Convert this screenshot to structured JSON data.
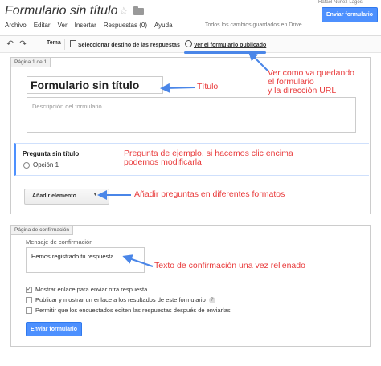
{
  "header": {
    "title": "Formulario sin título",
    "user_name": "Rafael Nuñez-Lagos",
    "send_button": "Enviar formulario",
    "star_icon": "star-icon",
    "folder_icon": "folder-icon"
  },
  "menu": {
    "items": [
      "Archivo",
      "Editar",
      "Ver",
      "Insertar",
      "Respuestas (0)",
      "Ayuda"
    ],
    "saved_status": "Todos los cambios guardados en Drive"
  },
  "toolbar": {
    "theme_label": "Tema",
    "destination_label": "Seleccionar destino de las respuestas",
    "view_published_label": "Ver el formulario publicado"
  },
  "page": {
    "page_tag": "Página 1 de 1",
    "form_title": "Formulario sin título",
    "description_placeholder": "Descripción del formulario"
  },
  "question": {
    "title": "Pregunta sin título",
    "option_1": "Opción 1"
  },
  "add_item": {
    "label": "Añadir elemento"
  },
  "confirmation": {
    "tag": "Página de confirmación",
    "message_label": "Mensaje de confirmación",
    "message_value": "Hemos registrado tu respuesta.",
    "option_1": "Mostrar enlace para enviar otra respuesta",
    "option_1_checked": true,
    "option_2": "Publicar y mostrar un enlace a los resultados de este formulario",
    "option_2_checked": false,
    "option_3": "Permitir que los encuestados editen las respuestas después de enviarlas",
    "option_3_checked": false,
    "send_button": "Enviar formulario"
  },
  "annotations": {
    "view_published": "Ver como va quedando\nel formulario\ny la dirección URL",
    "title": "Título",
    "example_question": "Pregunta de ejemplo, si hacemos clic encima\npodemos modificarla",
    "add_questions": "Añadir preguntas en diferentes formatos",
    "confirmation_text": "Texto de confirmación una vez rellenado"
  },
  "colors": {
    "annotation": "#e8393a",
    "arrow": "#4a86e8",
    "primary_button": "#4d90fe"
  }
}
